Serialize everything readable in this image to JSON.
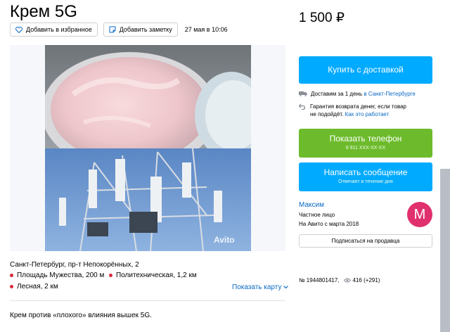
{
  "listing": {
    "title": "Крем 5G",
    "favorite_label": "Добавить в избранное",
    "note_label": "Добавить заметку",
    "date": "27 мая в 10:06",
    "watermark": "Avito"
  },
  "location": {
    "address": "Санкт-Петербург, пр-т Непокорённых, 2",
    "metro": [
      {
        "name": "Площадь Мужества, 200 м"
      },
      {
        "name": "Политехническая, 1,2 км"
      },
      {
        "name": "Лесная, 2 км"
      }
    ],
    "metro_color": "#d9263b",
    "show_map_label": "Показать карту"
  },
  "description": "Крем против «плохого» влияния вышек 5G.",
  "sidebar": {
    "price": "1 500 ₽",
    "buy_label": "Купить с доставкой",
    "delivery_text": "Доставим за 1 день",
    "delivery_city": "в Санкт-Петербурге",
    "guarantee_text_1": "Гарантия возврата денег, если товар",
    "guarantee_text_2": "не подойдёт.",
    "guarantee_link": "Как это работает",
    "phone_label": "Показать телефон",
    "phone_masked": "8 911 XXX-XX-XX",
    "message_label": "Написать сообщение",
    "message_sub": "Отвечает в течение дня",
    "seller_name": "Максим",
    "seller_type": "Частное лицо",
    "seller_since": "На Авито с марта 2018",
    "avatar_letter": "M",
    "subscribe_label": "Подписаться на продавца",
    "ad_number": "№ 1944801417,",
    "views": "416 (+291)"
  },
  "colors": {
    "accent_blue": "#00aaff",
    "phone_green": "#6dbb2c",
    "link": "#0a69c5",
    "avatar": "#e0306e"
  }
}
